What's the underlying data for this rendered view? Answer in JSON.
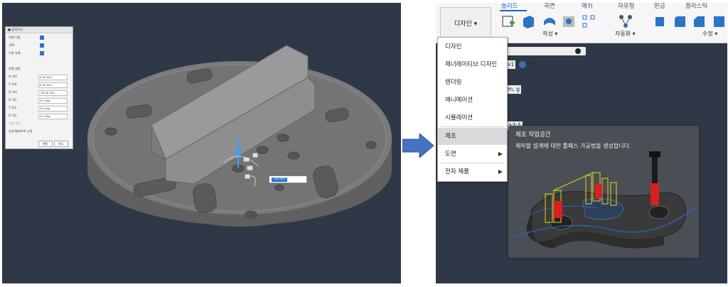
{
  "left": {
    "dialog": {
      "title": "■ 움직이기",
      "rows": [
        "객체 이동",
        "선택",
        "이동 유형",
        "",
        "피벗 설정",
        "X 거리",
        "Y 거리",
        "Z 거리",
        "X 각도",
        "Y 각도",
        "Z 각도",
        "사본 작성",
        "상대 형태으로 고정"
      ],
      "values": [
        "0.00 mm",
        "0.00 mm",
        "-30.00 mm",
        "0.0 deg",
        "0.0 deg",
        "0.0 deg"
      ],
      "ok": "확인",
      "cancel": "취소"
    },
    "drag_value": "-30 mm"
  },
  "right": {
    "workspace_button": "디자인 ▾",
    "tabs": [
      "솔리드",
      "곡면",
      "메쉬",
      "자유형",
      "판금",
      "플라스틱"
    ],
    "groups": {
      "create": "작성 ▾",
      "automate": "자동화 ▾",
      "modify": "수정 ▾"
    },
    "menu": {
      "items": [
        "디자인",
        "제너레이티브 디자인",
        "렌더링",
        "애니메이션",
        "시뮬레이션",
        "제조",
        "도면",
        "전자 제품"
      ],
      "highlighted_index": 5
    },
    "browser": {
      "version": "v1",
      "units": "m, g",
      "origin": "소1:1"
    },
    "tooltip": {
      "title": "제조 작업공간",
      "description": "제작할 설계에 대한 툴패스 가공법을 생성합니다."
    }
  },
  "colors": {
    "viewport": "#2f3846",
    "accent": "#1a64c8",
    "arrow": "#4472c4"
  }
}
